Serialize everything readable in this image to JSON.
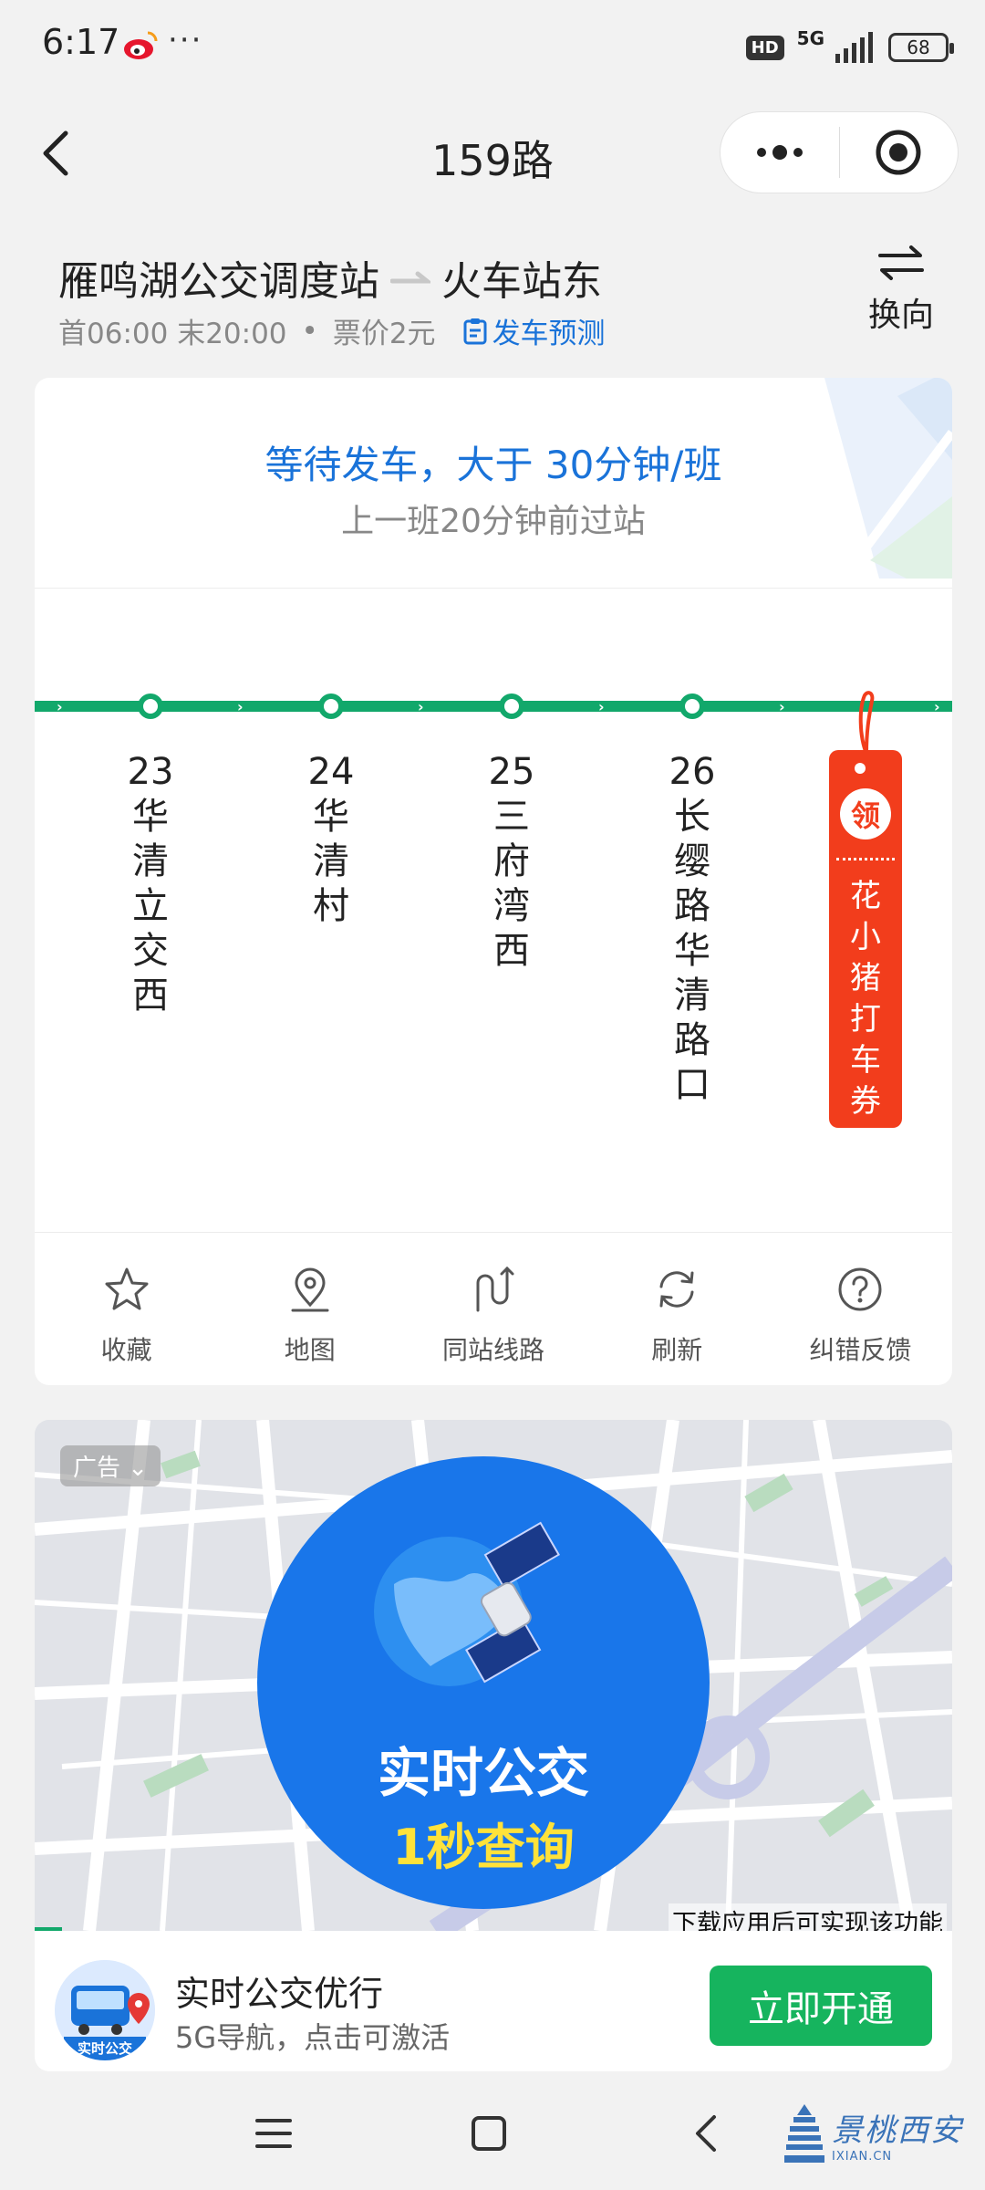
{
  "status_bar": {
    "time": "6:17",
    "dots": "···",
    "hd": "HD",
    "network": "5G",
    "battery": "68"
  },
  "header": {
    "title": "159路"
  },
  "route": {
    "from": "雁鸣湖公交调度站",
    "to": "火车站东",
    "hours": "首06:00 末20:00",
    "separator": "•",
    "fare": "票价2元",
    "forecast_link": "发车预测",
    "reverse_label": "换向"
  },
  "status": {
    "waiting": "等待发车，大于 30分钟/班",
    "last_bus": "上一班20分钟前过站"
  },
  "stops": [
    {
      "num": "23",
      "name": "华清立交西"
    },
    {
      "num": "24",
      "name": "华清村"
    },
    {
      "num": "25",
      "name": "三府湾西"
    },
    {
      "num": "26",
      "name": "长缨路华清路口"
    }
  ],
  "coupon": {
    "badge": "领",
    "text": "花小猪打车券"
  },
  "actions": [
    {
      "label": "收藏",
      "icon": "star-icon"
    },
    {
      "label": "地图",
      "icon": "map-pin-icon"
    },
    {
      "label": "同站线路",
      "icon": "route-icon"
    },
    {
      "label": "刷新",
      "icon": "refresh-icon"
    },
    {
      "label": "纠错反馈",
      "icon": "help-icon"
    }
  ],
  "ad": {
    "tag": "广告",
    "headline": "实时公交",
    "subheadline": "1秒查询",
    "download_note": "下载应用后可实现该功能",
    "app_icon_text": "实时公交",
    "app_title": "实时公交优行",
    "app_desc": "5G导航，点击可激活",
    "cta": "立即开通"
  },
  "watermark": {
    "text": "景桃西安",
    "url": "IXIAN.CN"
  },
  "colors": {
    "accent_blue": "#1a73d9",
    "route_green": "#12a86b",
    "coupon_red": "#f23d1c",
    "cta_green": "#16b45e",
    "ad_blue": "#1976ea"
  }
}
